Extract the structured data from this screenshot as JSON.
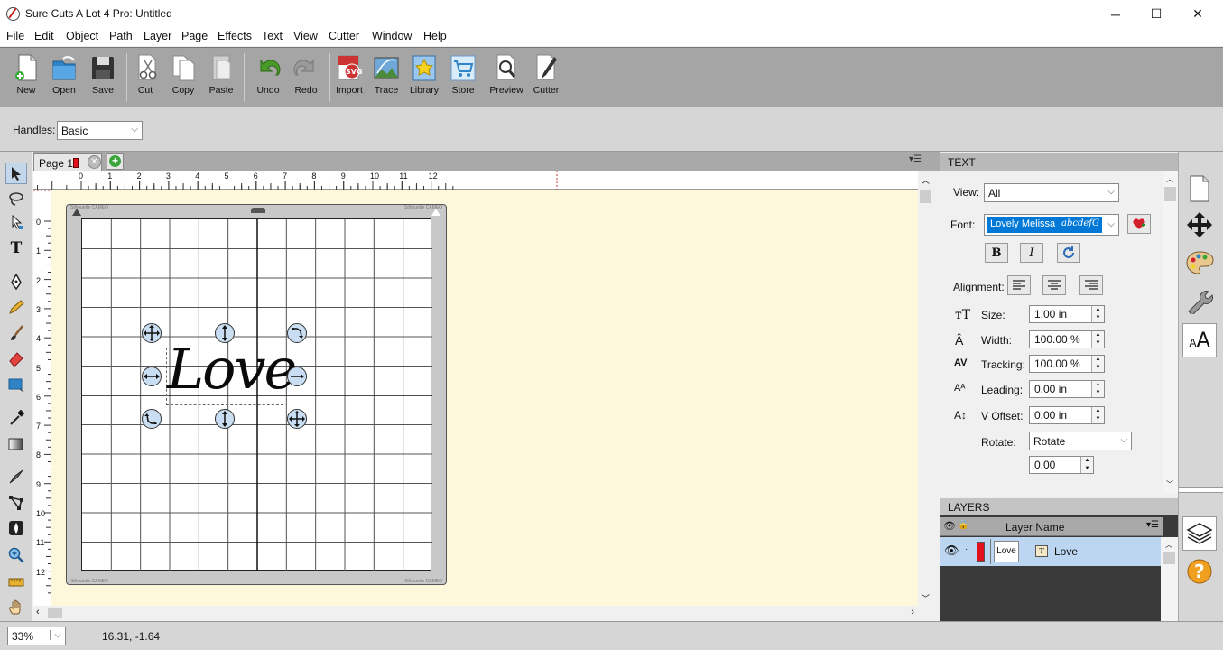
{
  "window": {
    "title": "Sure Cuts A Lot 4 Pro: Untitled",
    "minimize": "─",
    "maximize": "☐",
    "close": "✕"
  },
  "menu": [
    "File",
    "Edit",
    "Object",
    "Path",
    "Layer",
    "Page",
    "Effects",
    "Text",
    "View",
    "Cutter",
    "Window",
    "Help"
  ],
  "toolbar": {
    "new": "New",
    "open": "Open",
    "save": "Save",
    "cut": "Cut",
    "copy": "Copy",
    "paste": "Paste",
    "undo": "Undo",
    "redo": "Redo",
    "import": "Import",
    "trace": "Trace",
    "library": "Library",
    "store": "Store",
    "preview": "Preview",
    "cutter": "Cutter"
  },
  "props": {
    "handles_label": "Handles:",
    "handles_value": "Basic"
  },
  "page_tab": {
    "label": "Page 1",
    "color": "#e0101e"
  },
  "ruler": {
    "h_ticks": [
      "0",
      "1",
      "2",
      "3",
      "4",
      "5",
      "6",
      "7",
      "8",
      "9",
      "10",
      "11",
      "12"
    ],
    "v_ticks": [
      "0",
      "1",
      "2",
      "3",
      "4",
      "5",
      "6",
      "7",
      "8",
      "9",
      "10",
      "11",
      "12"
    ]
  },
  "mat": {
    "brand_tl": "Silhouette CAMEO",
    "brand_tr": "Silhouette CAMEO",
    "brand_bl": "Silhouette CAMEO",
    "brand_br": "Silhouette CAMEO"
  },
  "canvas_text": "Love",
  "status": {
    "zoom": "33%",
    "coords": "16.31, -1.64"
  },
  "text_panel": {
    "header": "TEXT",
    "view_label": "View:",
    "view_value": "All",
    "font_label": "Font:",
    "font_value": "Lovely Melissa",
    "font_sample": "abcdefG",
    "bold": "B",
    "italic": "I",
    "alignment_label": "Alignment:",
    "size_label": "Size:",
    "size_value": "1.00 in",
    "width_label": "Width:",
    "width_value": "100.00 %",
    "tracking_label": "Tracking:",
    "tracking_value": "100.00 %",
    "leading_label": "Leading:",
    "leading_value": "0.00 in",
    "voffset_label": "V Offset:",
    "voffset_value": "0.00 in",
    "rotate_label": "Rotate:",
    "rotate_value": "Rotate",
    "rotate_angle": "0.00"
  },
  "layers_panel": {
    "header": "LAYERS",
    "column": "Layer Name",
    "layer_thumb": "Love",
    "layer_name": "Love",
    "layer_color": "#e0101e"
  },
  "colors": {
    "accent": "#0078d7",
    "toolbar_bg": "#a5a5a5",
    "canvas_bg": "#fdf7dc",
    "handle_fill": "#c9def2"
  }
}
